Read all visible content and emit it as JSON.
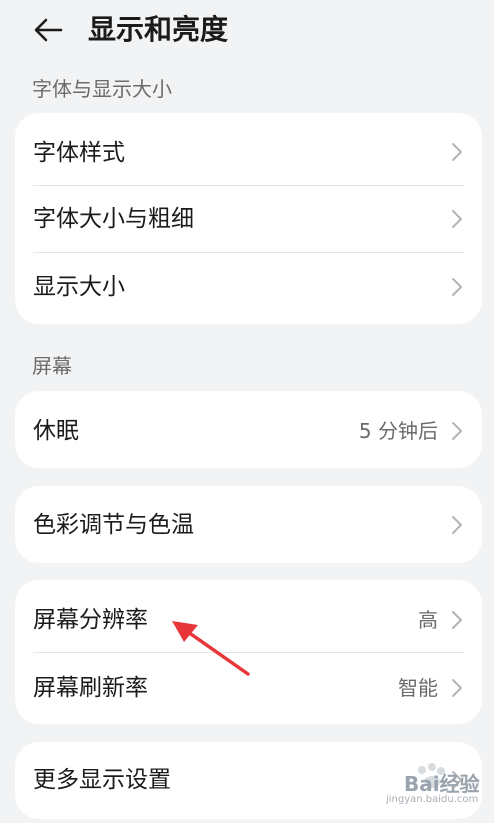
{
  "header": {
    "title": "显示和亮度"
  },
  "sections": {
    "font_display": "字体与显示大小",
    "screen": "屏幕"
  },
  "font_card": {
    "items": [
      {
        "label": "字体样式"
      },
      {
        "label": "字体大小与粗细"
      },
      {
        "label": "显示大小"
      }
    ]
  },
  "sleep_card": {
    "label": "休眠",
    "value": "5 分钟后"
  },
  "color_card": {
    "label": "色彩调节与色温"
  },
  "resolution_card": {
    "items": [
      {
        "label": "屏幕分辨率",
        "value": "高"
      },
      {
        "label": "屏幕刷新率",
        "value": "智能"
      }
    ]
  },
  "more_card": {
    "label": "更多显示设置"
  },
  "watermark": {
    "text": "Bai经验",
    "url": "jingyan.baidu.com"
  },
  "colors": {
    "background": "#f1f3f5",
    "card": "#ffffff",
    "annotation_arrow": "#e8373a"
  }
}
